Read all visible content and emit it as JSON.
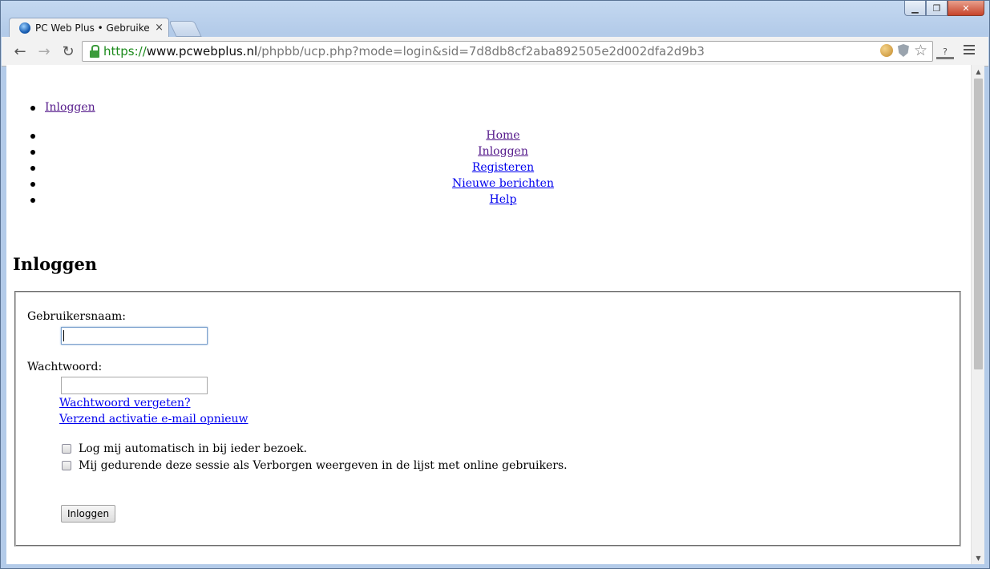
{
  "browser": {
    "tab_active_title": "PC Web Plus • Gebruikersp",
    "url_https": "https://",
    "url_host": "www.pcwebplus.nl",
    "url_path": "/phpbb/ucp.php?mode=login&sid=7d8db8cf2aba892505e2d002dfa2d9b3",
    "star_glyph": "☆",
    "back_glyph": "←",
    "forward_glyph": "→",
    "reload_glyph": "↻",
    "close_glyph": "×",
    "ext_glyph": "?"
  },
  "top_menu": {
    "items": [
      {
        "label": "Inloggen"
      }
    ]
  },
  "nav": {
    "items": [
      {
        "label": "Home"
      },
      {
        "label": "Inloggen"
      },
      {
        "label": "Registeren"
      },
      {
        "label": "Nieuwe berichten"
      },
      {
        "label": "Help"
      }
    ]
  },
  "page": {
    "title": "Inloggen"
  },
  "login": {
    "username_label": "Gebruikersnaam:",
    "username_value": "",
    "password_label": "Wachtwoord:",
    "password_value": "",
    "forgot_password": "Wachtwoord vergeten?",
    "resend_activation": "Verzend activatie e-mail opnieuw",
    "autologin_label": "Log mij automatisch in bij ieder bezoek.",
    "autologin_checked": false,
    "hidden_label": "Mij gedurende deze sessie als Verborgen weergeven in de lijst met online gebruikers.",
    "hidden_checked": false,
    "submit_label": "Inloggen"
  },
  "colors": {
    "visited_link": "#551a8b",
    "link": "#0000ee",
    "https_green": "#1b8a1b"
  }
}
